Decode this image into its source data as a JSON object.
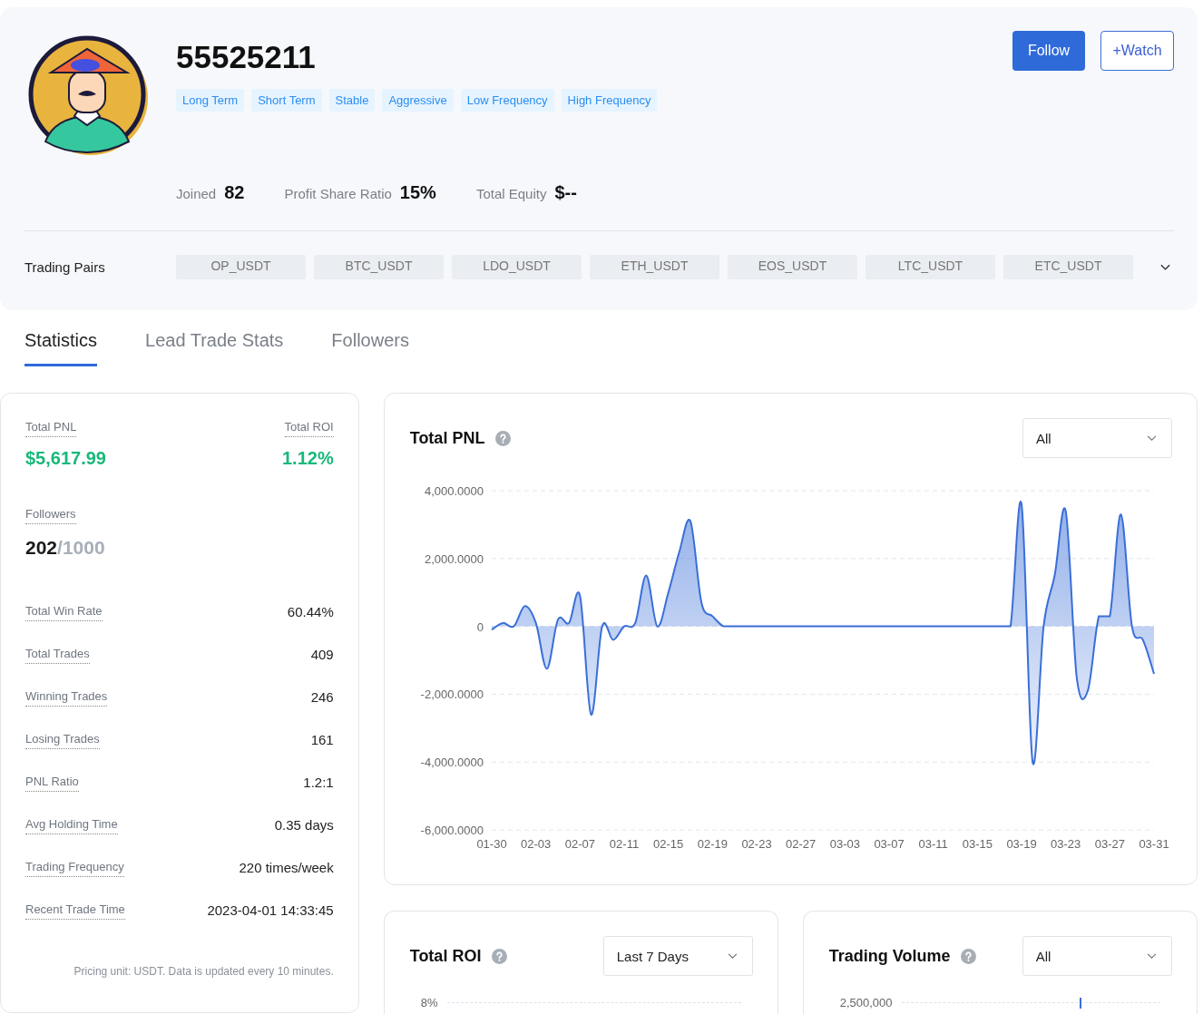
{
  "profile": {
    "name": "55525211",
    "tags": [
      "Long Term",
      "Short Term",
      "Stable",
      "Aggressive",
      "Low Frequency",
      "High Frequency"
    ],
    "stats": [
      {
        "label": "Joined",
        "value": "82"
      },
      {
        "label": "Profit Share Ratio",
        "value": "15%"
      },
      {
        "label": "Total Equity",
        "value": "$--"
      }
    ]
  },
  "actions": [
    {
      "label": "Follow",
      "kind": "primary"
    },
    {
      "label": "+Watch",
      "kind": "outline"
    }
  ],
  "trading_pairs": {
    "label": "Trading Pairs",
    "pairs": [
      "OP_USDT",
      "BTC_USDT",
      "LDO_USDT",
      "ETH_USDT",
      "EOS_USDT",
      "LTC_USDT",
      "ETC_USDT"
    ]
  },
  "tabs": [
    {
      "label": "Statistics",
      "selected": true
    },
    {
      "label": "Lead Trade Stats",
      "selected": false
    },
    {
      "label": "Followers",
      "selected": false
    }
  ],
  "summary": {
    "total_pnl": {
      "label": "Total PNL",
      "value": "$5,617.99"
    },
    "total_roi": {
      "label": "Total ROI",
      "value": "1.12%"
    },
    "followers": {
      "label": "Followers",
      "count": "202",
      "limit": "/1000"
    },
    "rows": [
      {
        "label": "Total Win Rate",
        "value": "60.44%"
      },
      {
        "label": "Total Trades",
        "value": "409"
      },
      {
        "label": "Winning Trades",
        "value": "246"
      },
      {
        "label": "Losing Trades",
        "value": "161"
      },
      {
        "label": "PNL Ratio",
        "value": "1.2:1"
      },
      {
        "label": "Avg Holding Time",
        "value": "0.35 days"
      },
      {
        "label": "Trading Frequency",
        "value": "220 times/week"
      },
      {
        "label": "Recent Trade Time",
        "value": "2023-04-01 14:33:45"
      }
    ],
    "note": "Pricing unit: USDT. Data is updated every 10 minutes."
  },
  "pnl_chart": {
    "title": "Total PNL",
    "filter": "All",
    "chart_data": {
      "type": "area",
      "grid": true,
      "ylim": [
        -6000,
        4000
      ],
      "categories": [
        "01-30",
        null,
        null,
        null,
        "02-03",
        null,
        null,
        null,
        "02-07",
        null,
        null,
        null,
        "02-11",
        null,
        null,
        null,
        "02-15",
        null,
        null,
        null,
        "02-19",
        null,
        null,
        null,
        "02-23",
        null,
        null,
        null,
        "02-27",
        null,
        null,
        null,
        "03-03",
        null,
        null,
        null,
        "03-07",
        null,
        null,
        null,
        "03-11",
        null,
        null,
        null,
        "03-15",
        null,
        null,
        null,
        "03-19",
        null,
        null,
        null,
        "03-23",
        null,
        null,
        null,
        "03-27",
        null,
        null,
        null,
        "03-31"
      ],
      "series": [
        {
          "color": "#3a6fd8",
          "values": [
            -100,
            100,
            0,
            600,
            100,
            -1250,
            200,
            100,
            900,
            -2600,
            0,
            -400,
            0,
            100,
            1500,
            0,
            1000,
            2200,
            3100,
            700,
            300,
            0,
            0,
            0,
            0,
            0,
            0,
            0,
            0,
            0,
            0,
            0,
            0,
            0,
            0,
            0,
            0,
            0,
            0,
            0,
            0,
            0,
            0,
            0,
            0,
            0,
            0,
            0,
            3600,
            -4000,
            0,
            1500,
            3400,
            -1500,
            -1900,
            300,
            300,
            3300,
            0,
            -400,
            -1400
          ]
        }
      ],
      "yticks": [
        {
          "value": 4000,
          "label": "4,000.0000"
        },
        {
          "value": 2000,
          "label": "2,000.0000"
        },
        {
          "value": 0,
          "label": "0"
        },
        {
          "value": -2000,
          "label": "-2,000.0000"
        },
        {
          "value": -4000,
          "label": "-4,000.0000"
        },
        {
          "value": -6000,
          "label": "-6,000.0000"
        }
      ]
    }
  },
  "roi_chart": {
    "title": "Total ROI",
    "filter": "Last 7 Days",
    "tick": "8%"
  },
  "volume_chart": {
    "title": "Trading Volume",
    "filter": "All",
    "tick": "2,500,000"
  }
}
